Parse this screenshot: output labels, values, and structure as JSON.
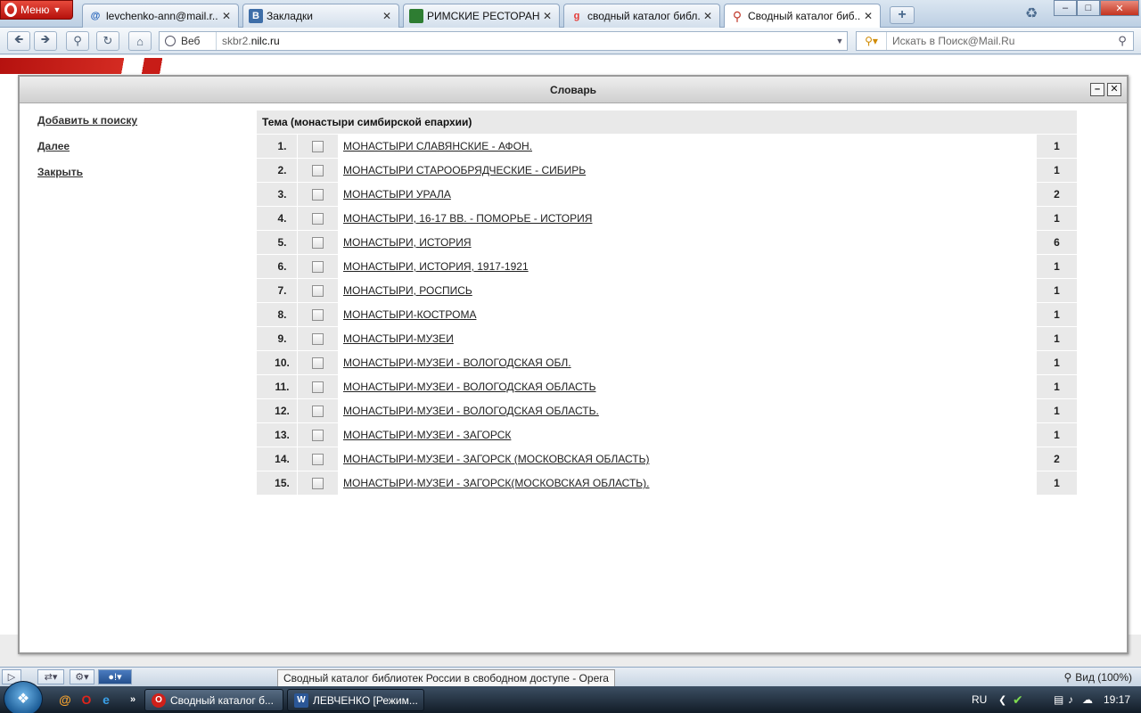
{
  "browser": {
    "menu_label": "Меню",
    "tabs": [
      {
        "title": "levchenko-ann@mail.r...",
        "favicon": "@",
        "favicon_color": "#1f5fb8"
      },
      {
        "title": "Закладки",
        "favicon": "B",
        "favicon_color": "#3e6ea8"
      },
      {
        "title": "РИМСКИЕ РЕСТОРАН...",
        "favicon": "",
        "favicon_color": "#2e7d32"
      },
      {
        "title": "сводный каталог библ...",
        "favicon": "g",
        "favicon_color": "#e53935"
      },
      {
        "title": "Сводный каталог биб...",
        "favicon": "",
        "favicon_color": "#c0392b"
      }
    ],
    "address": {
      "web_label": "Веб",
      "url_prefix": "skbr2.",
      "url_host": "nilc.ru"
    },
    "search": {
      "placeholder": "Искать в Поиск@Mail.Ru"
    }
  },
  "dialog": {
    "title": "Словарь",
    "actions": {
      "add": "Добавить к поиску",
      "next": "Далее",
      "close": "Закрыть"
    },
    "table_header": "Тема (монастыри симбирской епархии)",
    "rows": [
      {
        "num": "1.",
        "term": "МОНАСТЫРИ СЛАВЯНСКИЕ - АФОН.",
        "count": "1"
      },
      {
        "num": "2.",
        "term": "МОНАСТЫРИ СТАРООБРЯДЧЕСКИЕ - СИБИРЬ",
        "count": "1"
      },
      {
        "num": "3.",
        "term": "МОНАСТЫРИ УРАЛА",
        "count": "2"
      },
      {
        "num": "4.",
        "term": "МОНАСТЫРИ, 16-17 ВВ. - ПОМОРЬЕ - ИСТОРИЯ",
        "count": "1"
      },
      {
        "num": "5.",
        "term": "МОНАСТЫРИ, ИСТОРИЯ",
        "count": "6"
      },
      {
        "num": "6.",
        "term": "МОНАСТЫРИ, ИСТОРИЯ, 1917-1921",
        "count": "1"
      },
      {
        "num": "7.",
        "term": "МОНАСТЫРИ, РОСПИСЬ",
        "count": "1"
      },
      {
        "num": "8.",
        "term": "МОНАСТЫРИ-КОСТРОМА",
        "count": "1"
      },
      {
        "num": "9.",
        "term": "МОНАСТЫРИ-МУЗЕИ",
        "count": "1"
      },
      {
        "num": "10.",
        "term": "МОНАСТЫРИ-МУЗЕИ - ВОЛОГОДСКАЯ ОБЛ.",
        "count": "1"
      },
      {
        "num": "11.",
        "term": "МОНАСТЫРИ-МУЗЕИ - ВОЛОГОДСКАЯ ОБЛАСТЬ",
        "count": "1"
      },
      {
        "num": "12.",
        "term": "МОНАСТЫРИ-МУЗЕИ - ВОЛОГОДСКАЯ ОБЛАСТЬ.",
        "count": "1"
      },
      {
        "num": "13.",
        "term": "МОНАСТЫРИ-МУЗЕИ - ЗАГОРСК",
        "count": "1"
      },
      {
        "num": "14.",
        "term": "МОНАСТЫРИ-МУЗЕИ - ЗАГОРСК (МОСКОВСКАЯ ОБЛАСТЬ)",
        "count": "2"
      },
      {
        "num": "15.",
        "term": "МОНАСТЫРИ-МУЗЕИ - ЗАГОРСК(МОСКОВСКАЯ ОБЛАСТЬ).",
        "count": "1"
      }
    ]
  },
  "status": {
    "tooltip": "Сводный каталог библиотек России в свободном доступе - Opera",
    "zoom_label": "Вид (100%)"
  },
  "taskbar": {
    "tasks": [
      {
        "title": "Сводный каталог б...",
        "icon": "O",
        "icon_color": "#d0201a"
      },
      {
        "title": "ЛЕВЧЕНКО [Режим...",
        "icon": "W",
        "icon_color": "#2b5797"
      }
    ],
    "lang": "RU",
    "clock": "19:17"
  },
  "colors": {
    "brand_red": "#c81c17",
    "table_bg": "#e9e9e9"
  }
}
